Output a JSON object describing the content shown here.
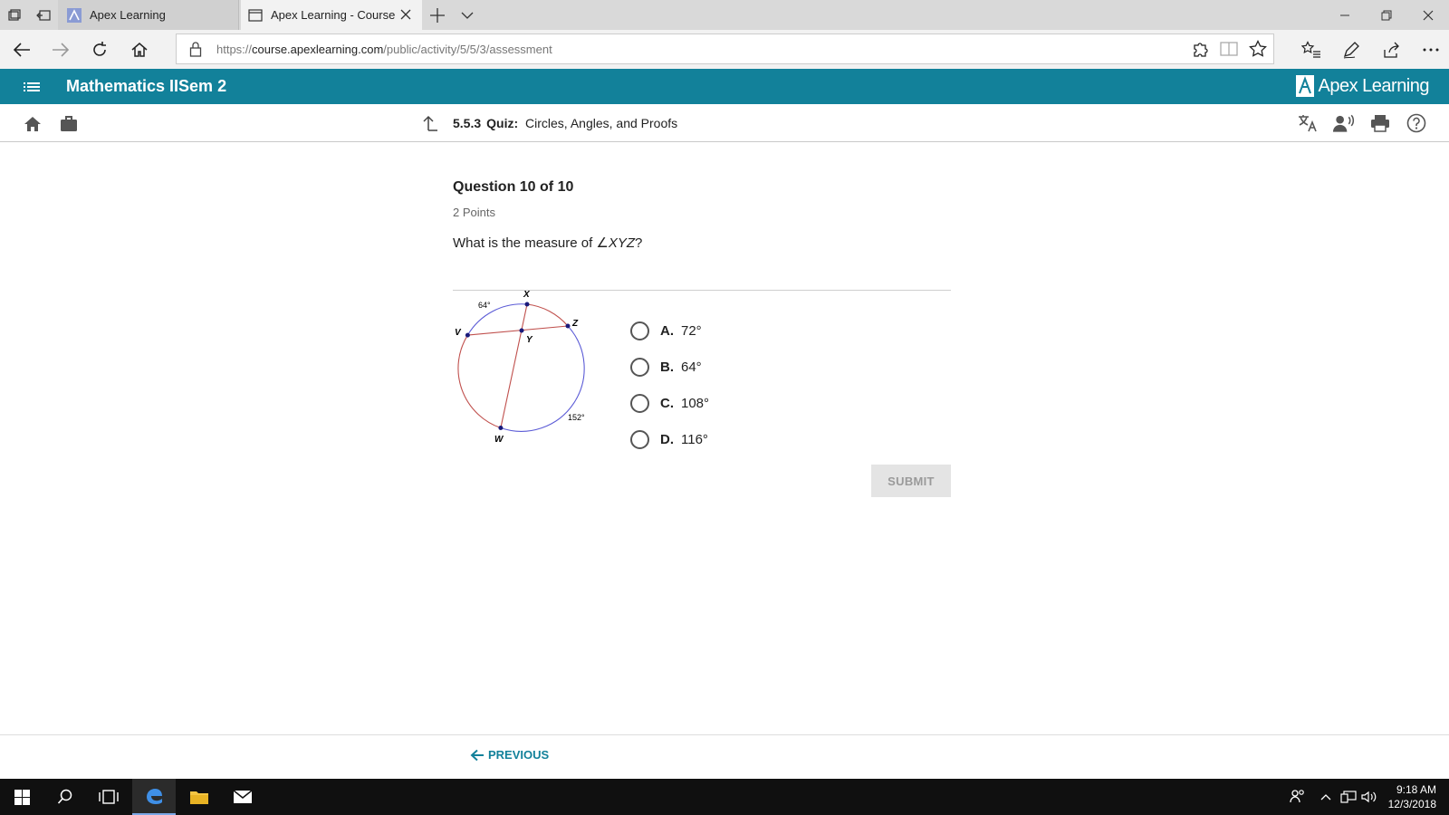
{
  "browser": {
    "tabs": [
      {
        "label": "Apex Learning"
      },
      {
        "label": "Apex Learning - Course"
      }
    ],
    "url": {
      "scheme": "https://",
      "host": "course.apexlearning.com",
      "path": "/public/activity/5/5/3/assessment"
    }
  },
  "course": {
    "title": "Mathematics IISem 2",
    "brand": "Apex Learning"
  },
  "breadcrumb": {
    "number": "5.5.3",
    "kind": "Quiz:",
    "name": "Circles, Angles, and Proofs"
  },
  "question": {
    "title": "Question 10 of 10",
    "points": "2 Points",
    "text_prefix": "What is the measure of ",
    "angle_symbol": "∠",
    "angle_name": "XYZ",
    "text_suffix": "?"
  },
  "diagram": {
    "labels": {
      "x": "X",
      "z": "Z",
      "v": "V",
      "y": "Y",
      "w": "W"
    },
    "arcs": {
      "top": "64°",
      "bottom": "152°"
    }
  },
  "answers": [
    {
      "letter": "A.",
      "value": "72°"
    },
    {
      "letter": "B.",
      "value": "64°"
    },
    {
      "letter": "C.",
      "value": "108°"
    },
    {
      "letter": "D.",
      "value": "116°"
    }
  ],
  "submit_label": "SUBMIT",
  "previous_label": "PREVIOUS",
  "taskbar": {
    "time": "9:18 AM",
    "date": "12/3/2018"
  },
  "colors": {
    "header": "#12819a",
    "circle_blue": "#5b5bd6",
    "circle_red": "#c0504d"
  }
}
